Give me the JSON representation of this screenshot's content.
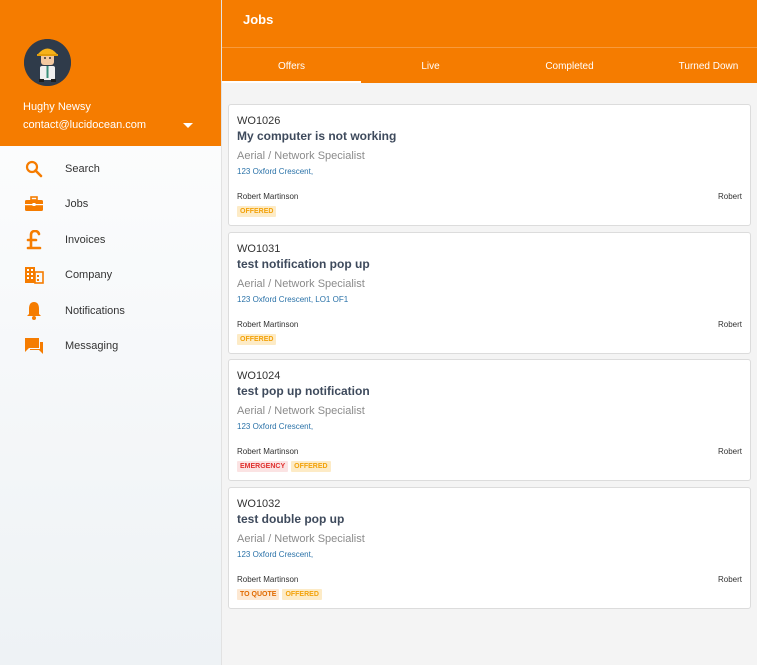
{
  "user": {
    "name": "Hughy Newsy",
    "email": "contact@lucidocean.com"
  },
  "nav": [
    {
      "label": "Search",
      "icon": "search-icon"
    },
    {
      "label": "Jobs",
      "icon": "briefcase-icon"
    },
    {
      "label": "Invoices",
      "icon": "pound-icon"
    },
    {
      "label": "Company",
      "icon": "building-icon"
    },
    {
      "label": "Notifications",
      "icon": "bell-icon"
    },
    {
      "label": "Messaging",
      "icon": "chat-icon"
    }
  ],
  "header": {
    "title": "Jobs"
  },
  "tabs": [
    {
      "label": "Offers",
      "active": true
    },
    {
      "label": "Live"
    },
    {
      "label": "Completed"
    },
    {
      "label": "Turned Down"
    }
  ],
  "jobs": [
    {
      "id": "WO1026",
      "title": "My computer is not working",
      "specialist": "Aerial / Network Specialist",
      "address": "123 Oxford Crescent,",
      "contact": "Robert Martinson",
      "assignee": "Robert",
      "badges": [
        "OFFERED"
      ]
    },
    {
      "id": "WO1031",
      "title": "test notification pop up",
      "specialist": "Aerial / Network Specialist",
      "address": "123 Oxford Crescent, LO1 OF1",
      "contact": "Robert Martinson",
      "assignee": "Robert",
      "badges": [
        "OFFERED"
      ]
    },
    {
      "id": "WO1024",
      "title": "test pop up notification",
      "specialist": "Aerial / Network Specialist",
      "address": "123 Oxford Crescent,",
      "contact": "Robert Martinson",
      "assignee": "Robert",
      "badges": [
        "EMERGENCY",
        "OFFERED"
      ]
    },
    {
      "id": "WO1032",
      "title": "test double pop up",
      "specialist": "Aerial / Network Specialist",
      "address": "123 Oxford Crescent,",
      "contact": "Robert Martinson",
      "assignee": "Robert",
      "badges": [
        "TO QUOTE",
        "OFFERED"
      ]
    }
  ],
  "colors": {
    "accent": "#f57c00",
    "offered": "#f2a20a",
    "emergency": "#e0312f",
    "quote": "#e06a00"
  }
}
